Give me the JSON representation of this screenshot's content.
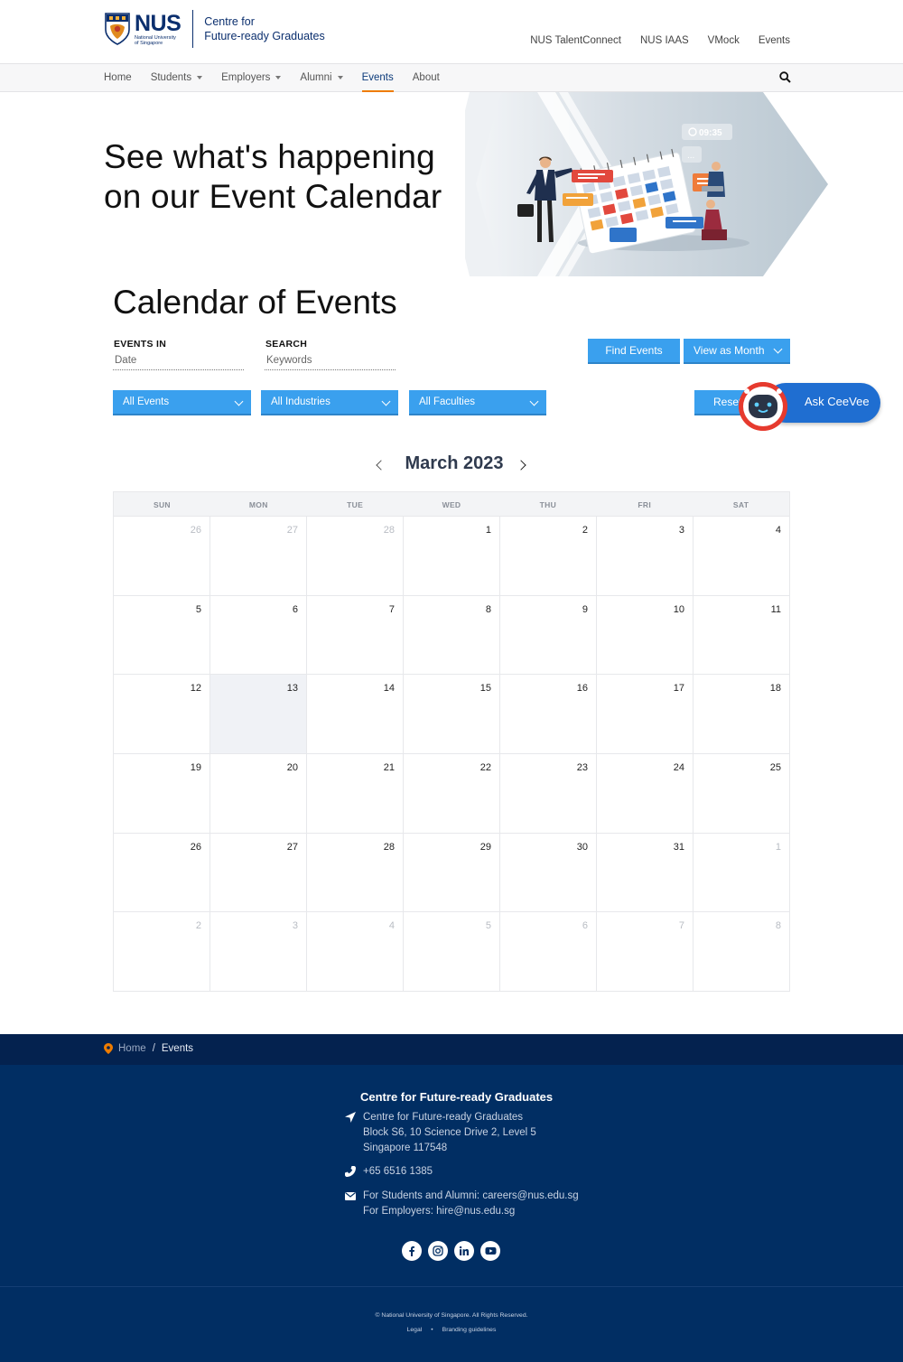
{
  "header": {
    "logo_word": "NUS",
    "logo_sub_1": "National University",
    "logo_sub_2": "of Singapore",
    "centre_line_1": "Centre for",
    "centre_line_2": "Future-ready Graduates",
    "top_links": [
      "NUS TalentConnect",
      "NUS IAAS",
      "VMock",
      "Events"
    ]
  },
  "nav": {
    "items": [
      {
        "label": "Home",
        "dropdown": false
      },
      {
        "label": "Students",
        "dropdown": true
      },
      {
        "label": "Employers",
        "dropdown": true
      },
      {
        "label": "Alumni",
        "dropdown": true
      },
      {
        "label": "Events",
        "dropdown": false,
        "active": true
      },
      {
        "label": "About",
        "dropdown": false
      }
    ],
    "search_icon": "search-icon",
    "active_color": "#ef7c00"
  },
  "hero": {
    "line_1": "See what's happening",
    "line_2": "on our Event Calendar",
    "clock_time": "09:35"
  },
  "calendar": {
    "title": "Calendar of Events",
    "events_in_label": "EVENTS IN",
    "events_in_placeholder": "Date",
    "search_label": "SEARCH",
    "search_placeholder": "Keywords",
    "find_button": "Find Events",
    "view_button": "View as Month",
    "filters": [
      "All Events",
      "All Industries",
      "All Faculties"
    ],
    "reset_button": "Reset",
    "month_label": "March 2023",
    "weekdays": [
      "SUN",
      "MON",
      "TUE",
      "WED",
      "THU",
      "FRI",
      "SAT"
    ],
    "days": [
      {
        "d": "26",
        "muted": true
      },
      {
        "d": "27",
        "muted": true
      },
      {
        "d": "28",
        "muted": true
      },
      {
        "d": "1"
      },
      {
        "d": "2"
      },
      {
        "d": "3"
      },
      {
        "d": "4"
      },
      {
        "d": "5"
      },
      {
        "d": "6"
      },
      {
        "d": "7"
      },
      {
        "d": "8"
      },
      {
        "d": "9"
      },
      {
        "d": "10"
      },
      {
        "d": "11"
      },
      {
        "d": "12"
      },
      {
        "d": "13",
        "today": true
      },
      {
        "d": "14"
      },
      {
        "d": "15"
      },
      {
        "d": "16"
      },
      {
        "d": "17"
      },
      {
        "d": "18"
      },
      {
        "d": "19"
      },
      {
        "d": "20"
      },
      {
        "d": "21"
      },
      {
        "d": "22"
      },
      {
        "d": "23"
      },
      {
        "d": "24"
      },
      {
        "d": "25"
      },
      {
        "d": "26"
      },
      {
        "d": "27"
      },
      {
        "d": "28"
      },
      {
        "d": "29"
      },
      {
        "d": "30"
      },
      {
        "d": "31"
      },
      {
        "d": "1",
        "muted": true
      },
      {
        "d": "2",
        "muted": true
      },
      {
        "d": "3",
        "muted": true
      },
      {
        "d": "4",
        "muted": true
      },
      {
        "d": "5",
        "muted": true
      },
      {
        "d": "6",
        "muted": true
      },
      {
        "d": "7",
        "muted": true
      },
      {
        "d": "8",
        "muted": true
      }
    ]
  },
  "chatbot": {
    "label": "Ask CeeVee"
  },
  "breadcrumb": {
    "home": "Home",
    "separator": "/",
    "current": "Events"
  },
  "footer": {
    "title": "Centre for Future-ready Graduates",
    "address_1": "Centre for Future-ready Graduates",
    "address_2": "Block S6, 10 Science Drive 2, Level 5",
    "address_3": "Singapore 117548",
    "phone": "+65 6516 1385",
    "email_students": "For Students and Alumni: careers@nus.edu.sg",
    "email_employers": "For Employers: hire@nus.edu.sg",
    "socials": [
      "facebook-icon",
      "instagram-icon",
      "linkedin-icon",
      "youtube-icon"
    ],
    "copyright": "© National University of Singapore. All Rights Reserved.",
    "legal": "Legal",
    "branding": "Branding guidelines"
  }
}
